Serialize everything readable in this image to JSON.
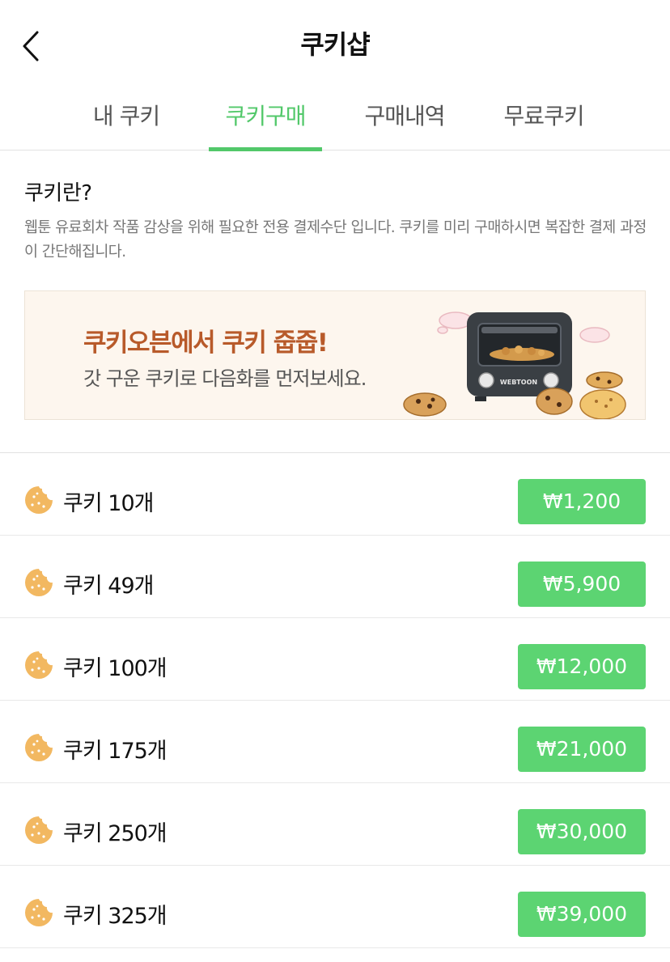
{
  "header": {
    "title": "쿠키샵",
    "back_icon": "chevron-left-icon"
  },
  "tabs": [
    {
      "label": "내 쿠키",
      "active": false
    },
    {
      "label": "쿠키구매",
      "active": true
    },
    {
      "label": "구매내역",
      "active": false
    },
    {
      "label": "무료쿠키",
      "active": false
    }
  ],
  "info": {
    "title": "쿠키란?",
    "description": "웹툰 유료회차 작품 감상을 위해 필요한 전용 결제수단 입니다. 쿠키를 미리 구매하시면 복잡한 결제 과정이 간단해집니다."
  },
  "banner": {
    "headline": "쿠키오븐에서 쿠키 줍줍!",
    "subtext": "갓 구운 쿠키로 다음화를 먼저보세요.",
    "oven_label": "WEBTOON"
  },
  "products": [
    {
      "name": "쿠키 10개",
      "price": "₩1,200"
    },
    {
      "name": "쿠키 49개",
      "price": "₩5,900"
    },
    {
      "name": "쿠키 100개",
      "price": "₩12,000"
    },
    {
      "name": "쿠키 175개",
      "price": "₩21,000"
    },
    {
      "name": "쿠키 250개",
      "price": "₩30,000"
    },
    {
      "name": "쿠키 325개",
      "price": "₩39,000"
    }
  ],
  "colors": {
    "accent": "#52c86a",
    "button": "#5cd472",
    "banner_headline": "#b85a2a",
    "cookie": "#f2b861"
  }
}
